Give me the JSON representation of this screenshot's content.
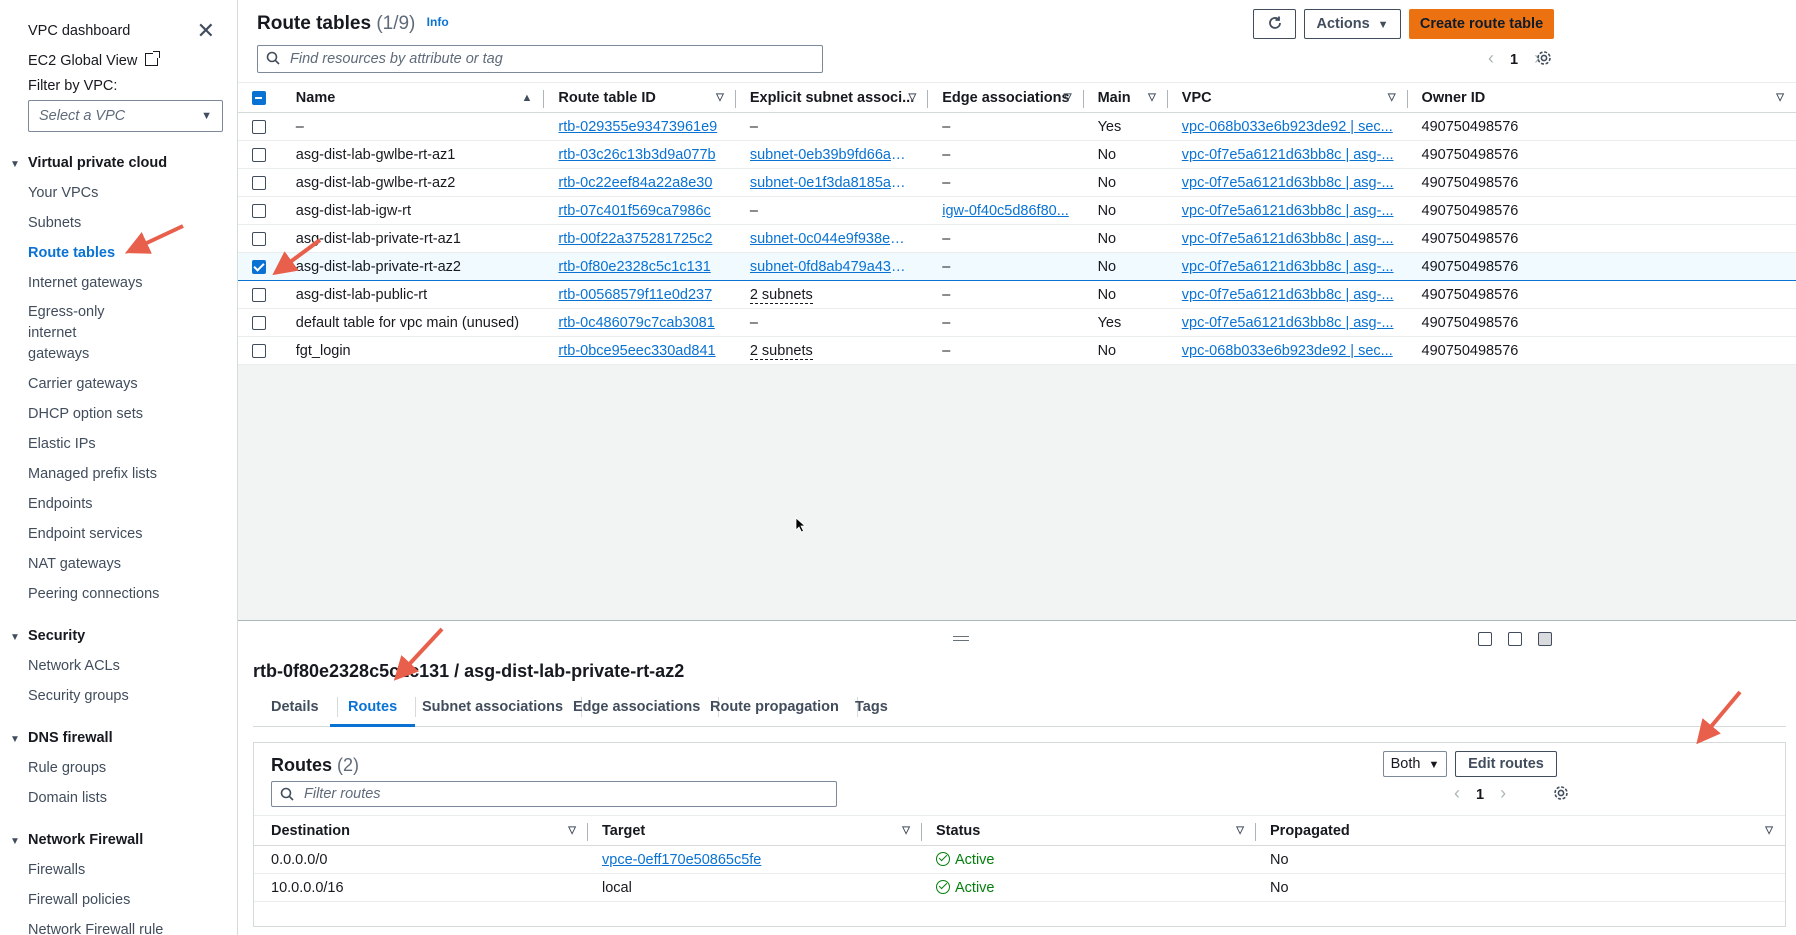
{
  "sidebar": {
    "dashboard_label": "VPC dashboard",
    "close_icon": "close-icon",
    "ec2_global_view_label": "EC2 Global View",
    "filter_label": "Filter by VPC:",
    "filter_placeholder": "Select a VPC",
    "sections": [
      {
        "title": "Virtual private cloud",
        "items": [
          "Your VPCs",
          "Subnets",
          "Route tables",
          "Internet gateways",
          "Egress-only internet gateways",
          "Carrier gateways",
          "DHCP option sets",
          "Elastic IPs",
          "Managed prefix lists",
          "Endpoints",
          "Endpoint services",
          "NAT gateways",
          "Peering connections"
        ]
      },
      {
        "title": "Security",
        "items": [
          "Network ACLs",
          "Security groups"
        ]
      },
      {
        "title": "DNS firewall",
        "items": [
          "Rule groups",
          "Domain lists"
        ]
      },
      {
        "title": "Network Firewall",
        "items": [
          "Firewalls",
          "Firewall policies",
          "Network Firewall rule"
        ]
      }
    ],
    "active_item": "Route tables"
  },
  "header": {
    "title": "Route tables",
    "count": "(1/9)",
    "info_label": "Info",
    "actions_label": "Actions",
    "create_label": "Create route table",
    "search_placeholder": "Find resources by attribute or tag",
    "page_number": "1"
  },
  "route_tables": {
    "columns": [
      "Name",
      "Route table ID",
      "Explicit subnet associ...",
      "Edge associations",
      "Main",
      "VPC",
      "Owner ID"
    ],
    "rows": [
      {
        "name": "–",
        "id": "rtb-029355e93473961e9",
        "subnet": "–",
        "subnet_type": "text",
        "edge": "–",
        "main": "Yes",
        "vpc": "vpc-068b033e6b923de92 | sec...",
        "owner": "490750498576",
        "selected": false
      },
      {
        "name": "asg-dist-lab-gwlbe-rt-az1",
        "id": "rtb-03c26c13b3d9a077b",
        "subnet": "subnet-0eb39b9fd66ad4...",
        "subnet_type": "link",
        "edge": "–",
        "main": "No",
        "vpc": "vpc-0f7e5a6121d63bb8c | asg-...",
        "owner": "490750498576",
        "selected": false
      },
      {
        "name": "asg-dist-lab-gwlbe-rt-az2",
        "id": "rtb-0c22eef84a22a8e30",
        "subnet": "subnet-0e1f3da8185a2f5...",
        "subnet_type": "link",
        "edge": "–",
        "main": "No",
        "vpc": "vpc-0f7e5a6121d63bb8c | asg-...",
        "owner": "490750498576",
        "selected": false
      },
      {
        "name": "asg-dist-lab-igw-rt",
        "id": "rtb-07c401f569ca7986c",
        "subnet": "–",
        "subnet_type": "text",
        "edge": "igw-0f40c5d86f80...",
        "main": "No",
        "vpc": "vpc-0f7e5a6121d63bb8c | asg-...",
        "owner": "490750498576",
        "selected": false
      },
      {
        "name": "asg-dist-lab-private-rt-az1",
        "id": "rtb-00f22a375281725c2",
        "subnet": "subnet-0c044e9f938eabc...",
        "subnet_type": "link",
        "edge": "–",
        "main": "No",
        "vpc": "vpc-0f7e5a6121d63bb8c | asg-...",
        "owner": "490750498576",
        "selected": false
      },
      {
        "name": "asg-dist-lab-private-rt-az2",
        "id": "rtb-0f80e2328c5c1c131",
        "subnet": "subnet-0fd8ab479a430e...",
        "subnet_type": "link",
        "edge": "–",
        "main": "No",
        "vpc": "vpc-0f7e5a6121d63bb8c | asg-...",
        "owner": "490750498576",
        "selected": true
      },
      {
        "name": "asg-dist-lab-public-rt",
        "id": "rtb-00568579f11e0d237",
        "subnet": "2 subnets",
        "subnet_type": "dotted",
        "edge": "–",
        "main": "No",
        "vpc": "vpc-0f7e5a6121d63bb8c | asg-...",
        "owner": "490750498576",
        "selected": false
      },
      {
        "name": "default table for vpc main (unused)",
        "id": "rtb-0c486079c7cab3081",
        "subnet": "–",
        "subnet_type": "text",
        "edge": "–",
        "main": "Yes",
        "vpc": "vpc-0f7e5a6121d63bb8c | asg-...",
        "owner": "490750498576",
        "selected": false
      },
      {
        "name": "fgt_login",
        "id": "rtb-0bce95eec330ad841",
        "subnet": "2 subnets",
        "subnet_type": "dotted",
        "edge": "–",
        "main": "No",
        "vpc": "vpc-068b033e6b923de92 | sec...",
        "owner": "490750498576",
        "selected": false
      }
    ]
  },
  "detail": {
    "title": "rtb-0f80e2328c5c1c131 / asg-dist-lab-private-rt-az2",
    "tabs": [
      "Details",
      "Routes",
      "Subnet associations",
      "Edge associations",
      "Route propagation",
      "Tags"
    ],
    "active_tab": "Routes",
    "routes": {
      "title": "Routes",
      "count": "(2)",
      "filter_select": "Both",
      "edit_label": "Edit routes",
      "search_placeholder": "Filter routes",
      "page_number": "1",
      "columns": [
        "Destination",
        "Target",
        "Status",
        "Propagated"
      ],
      "rows": [
        {
          "destination": "0.0.0.0/0",
          "target": "vpce-0eff170e50865c5fe",
          "target_link": true,
          "status": "Active",
          "propagated": "No"
        },
        {
          "destination": "10.0.0.0/16",
          "target": "local",
          "target_link": false,
          "status": "Active",
          "propagated": "No"
        }
      ]
    }
  },
  "colors": {
    "accent": "#0972d3",
    "primary_button": "#ec7211",
    "success": "#037f0c",
    "annotation_arrow": "#e8604c"
  }
}
